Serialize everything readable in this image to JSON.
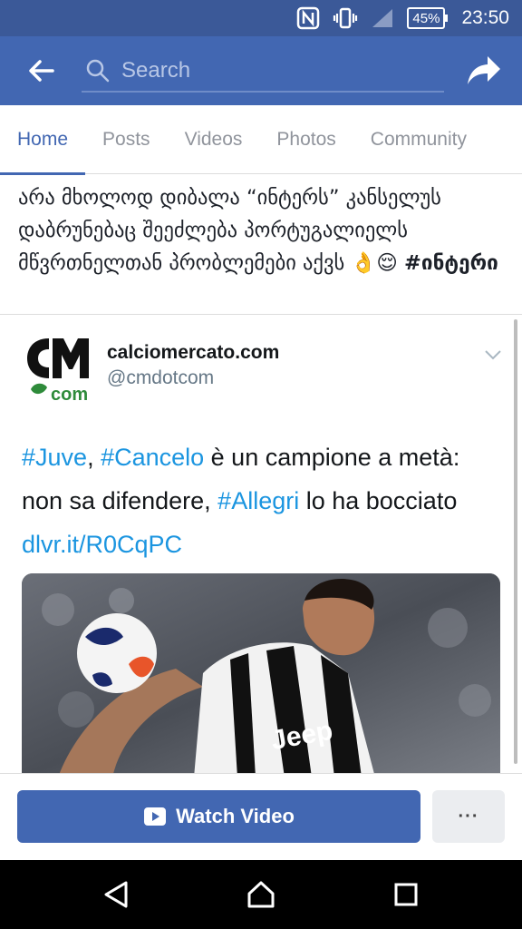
{
  "status_bar": {
    "nfc_icon": "nfc-icon",
    "vibrate_icon": "vibrate-icon",
    "signal_icon": "signal-icon",
    "battery": "45%",
    "time": "23:50"
  },
  "app_bar": {
    "back_icon": "back-arrow-icon",
    "search_placeholder": "Search",
    "share_icon": "share-icon"
  },
  "tabs": [
    {
      "label": "Home",
      "active": true
    },
    {
      "label": "Posts",
      "active": false
    },
    {
      "label": "Videos",
      "active": false
    },
    {
      "label": "Photos",
      "active": false
    },
    {
      "label": "Community",
      "active": false
    }
  ],
  "post": {
    "text": "არა მხოლოდ დიბალა “ინტერს” კანსელუს დაბრუნებაც შეეძლება პორტუგალიელს მწვრთნელთან პრობლემები აქვს 👌😌 ",
    "hashtag": "#ინტერი"
  },
  "embed": {
    "account_name": "calciomercato.com",
    "handle": "@cmdotcom",
    "tweet_parts": {
      "tag1": "#Juve",
      "sep1": ", ",
      "tag2": "#Cancelo",
      "text1": " è un campione a metà: non sa difendere, ",
      "tag3": "#Allegri",
      "text2": " lo ha bocciato ",
      "link": "dlvr.it/R0CqPC"
    }
  },
  "actions": {
    "watch_video_label": "Watch Video",
    "more_label": "···"
  },
  "colors": {
    "status_bar": "#3b5998",
    "app_bar": "#4267b2",
    "accent": "#4267b2",
    "tweet_link": "#1b95e0"
  }
}
